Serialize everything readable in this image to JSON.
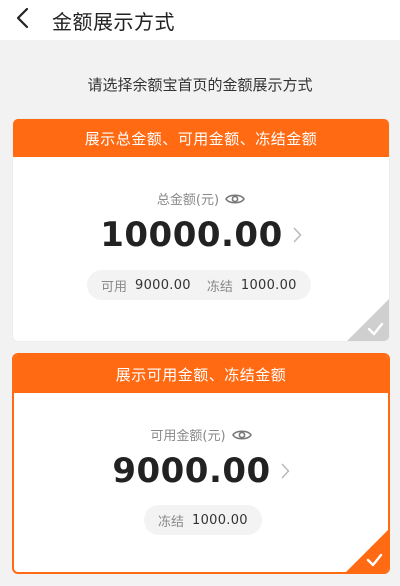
{
  "header": {
    "title": "金额展示方式",
    "back_icon": "chevron-left-icon"
  },
  "subtitle": "请选择余额宝首页的金额展示方式",
  "colors": {
    "accent": "#ff6a13",
    "check_inactive": "#cfcfcf"
  },
  "options": [
    {
      "header": "展示总金额、可用金额、冻结金额",
      "label": "总金额(元)",
      "amount": "10000.00",
      "available_label": "可用",
      "available_value": "9000.00",
      "frozen_label": "冻结",
      "frozen_value": "1000.00",
      "selected": false
    },
    {
      "header": "展示可用金额、冻结金额",
      "label": "可用金额(元)",
      "amount": "9000.00",
      "frozen_label": "冻结",
      "frozen_value": "1000.00",
      "selected": true
    }
  ]
}
